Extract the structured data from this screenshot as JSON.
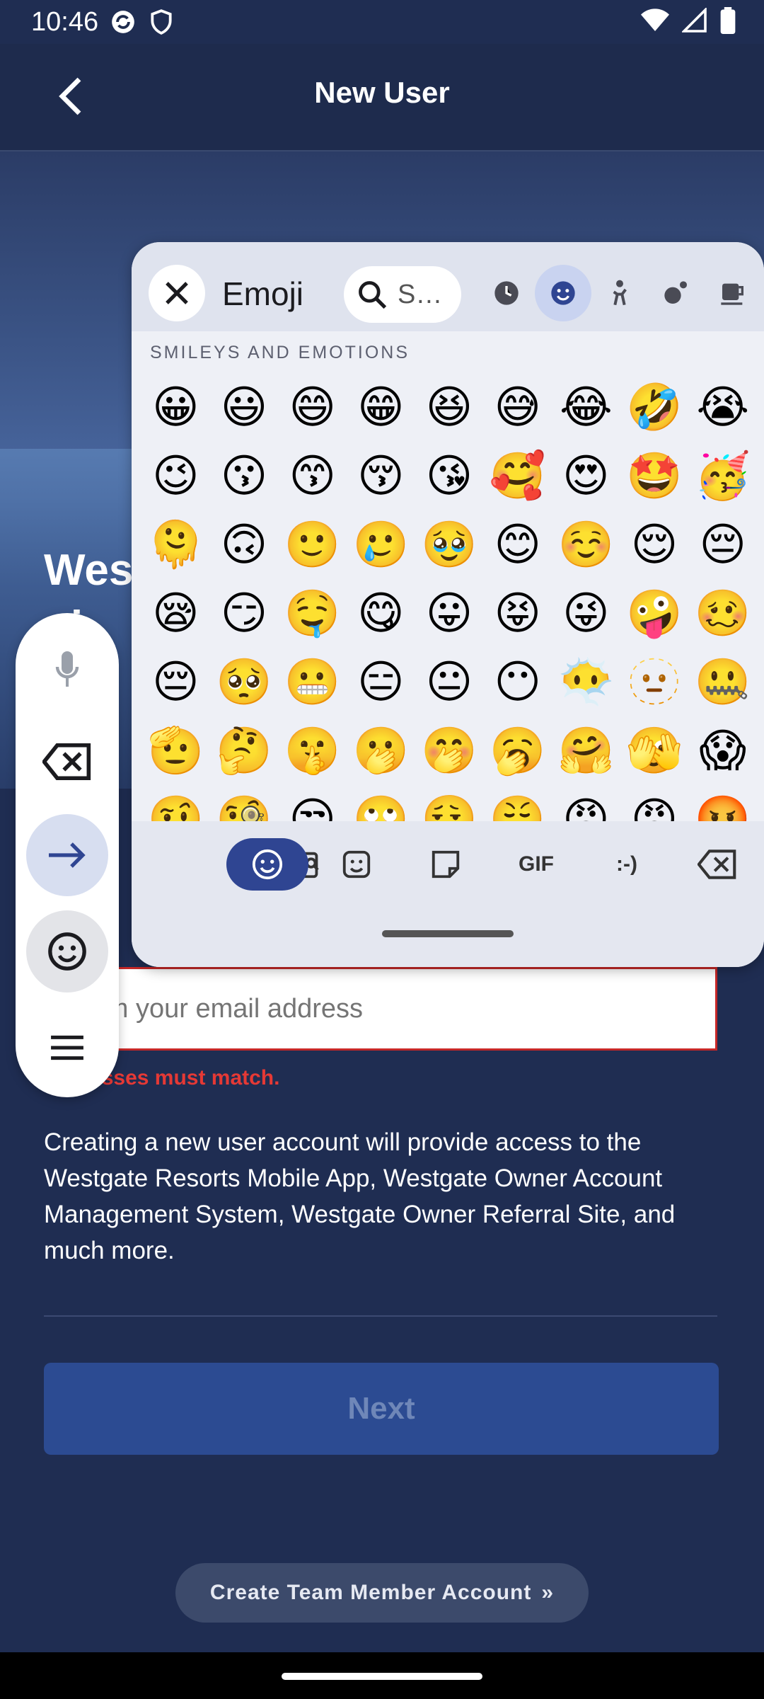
{
  "status": {
    "time": "10:46"
  },
  "header": {
    "title": "New User",
    "back_label": "Back"
  },
  "hero": {
    "title_fragment": "Wes",
    "subtitle_fragment": "gi"
  },
  "form": {
    "confirm_email_placeholder": "Confirm your email address",
    "confirm_email_visible": "nfirm your email address",
    "error_fragment": "addresses must match."
  },
  "info_text": "Creating a new user account will provide access to the Westgate Resorts Mobile App, Westgate Owner Account Management System, Westgate Owner Referral Site, and much more.",
  "buttons": {
    "next": "Next",
    "team_member": "Create Team Member Account",
    "team_member_icon": "»"
  },
  "emoji_panel": {
    "title": "Emoji",
    "search_placeholder": "S…",
    "section": "SMILEYS AND EMOTIONS",
    "rows": [
      [
        "😀",
        "😃",
        "😄",
        "😁",
        "😆",
        "😅",
        "😂",
        "🤣",
        "😭"
      ],
      [
        "😉",
        "😗",
        "😙",
        "😚",
        "😘",
        "🥰",
        "😍",
        "🤩",
        "🥳"
      ],
      [
        "🫠",
        "🙃",
        "🙂",
        "🥲",
        "🥹",
        "😊",
        "☺️",
        "😌",
        "😔"
      ],
      [
        "😪",
        "😏",
        "🤤",
        "😋",
        "😛",
        "😝",
        "😜",
        "🤪",
        "🥴"
      ],
      [
        "😔",
        "🥺",
        "😬",
        "😑",
        "😐",
        "😶",
        "😶‍🌫️",
        "🫥",
        "🤐"
      ],
      [
        "🫡",
        "🤔",
        "🤫",
        "🫢",
        "🤭",
        "🥱",
        "🤗",
        "🫣",
        "😱"
      ],
      [
        "🤨",
        "🧐",
        "😒",
        "🙄",
        "😮‍💨",
        "😤",
        "😠",
        "😡",
        "🤬"
      ]
    ],
    "footer": {
      "gif": "GIF",
      "emoticon": ":-)"
    }
  },
  "colors": {
    "accent": "#2f4592",
    "error": "#e53935",
    "header": "#1e2b4d"
  }
}
